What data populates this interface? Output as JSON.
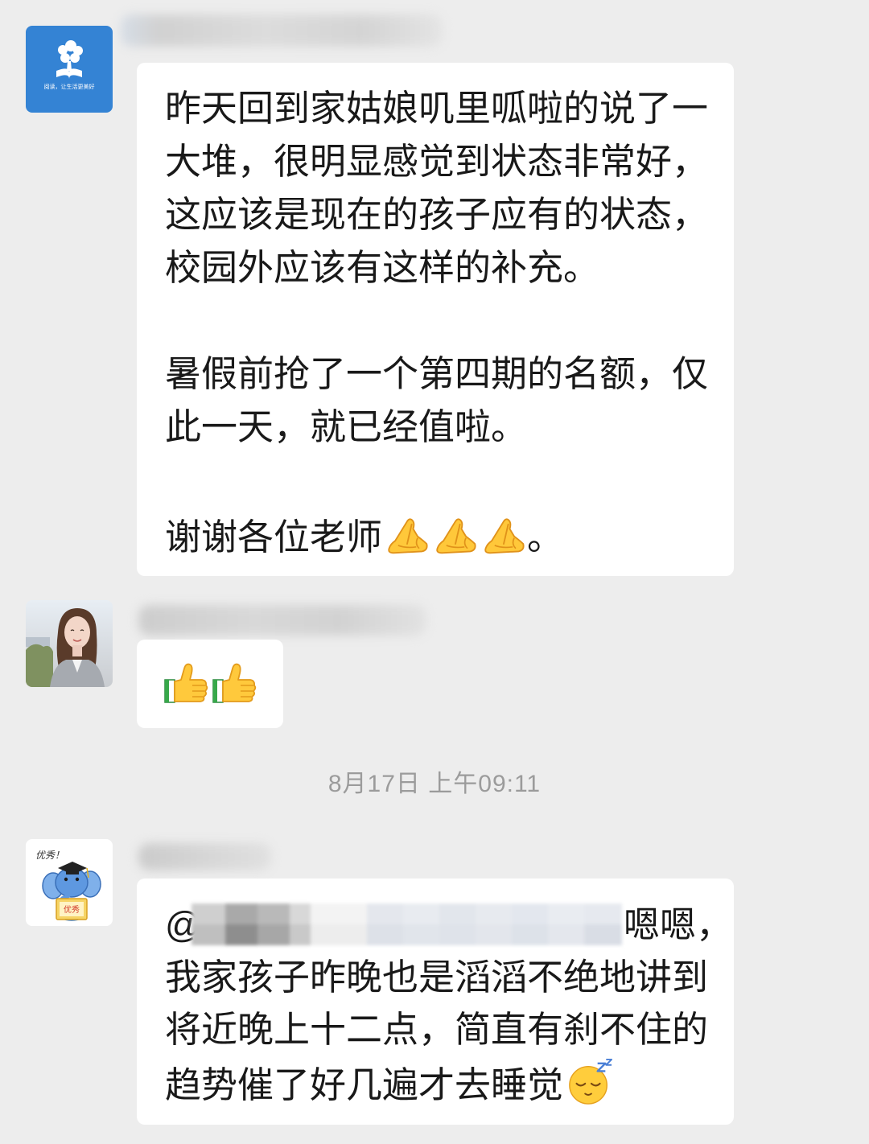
{
  "colors": {
    "page_background": "#ededed",
    "bubble_background": "#ffffff",
    "message_text": "#191919",
    "timestamp_text": "#9b9b9b",
    "logo_avatar_background": "#3483d4"
  },
  "messages": [
    {
      "avatar": {
        "icon": "reading-logo-avatar",
        "lettering": "阅读，让生活更美好"
      },
      "paragraphs": [
        [
          "昨天回到家姑娘叽里呱啦的说了一",
          "大堆，很明显感觉到状态非常好，",
          "这应该是现在的孩子应有的状态，",
          "校园外应该有这样的补充。"
        ],
        [
          "暑假前抢了一个第四期的名额，仅",
          "此一天，就已经值啦。"
        ]
      ],
      "closing": {
        "text": "谢谢各位老师",
        "emoji": [
          "pray-emoji",
          "pray-emoji",
          "pray-emoji"
        ],
        "suffix": "。"
      }
    },
    {
      "avatar": {
        "icon": "woman-portrait-photo-avatar"
      },
      "emoji": [
        "thumbs-up-emoji",
        "thumbs-up-emoji"
      ]
    },
    {
      "avatar": {
        "icon": "elephant-graduate-avatar",
        "lettering": [
          "优秀！",
          "优秀"
        ]
      },
      "mention_symbol": "@",
      "first_line_tail": "嗯嗯，",
      "lines": [
        "我家孩子昨晚也是滔滔不绝地讲到",
        "将近晚上十二点，简直有刹不住的"
      ],
      "last_line": {
        "text": "趋势催了好几遍才去睡觉",
        "emoji": "sleeping-face-emoji"
      }
    }
  ],
  "timestamp": "8月17日 上午09:11"
}
